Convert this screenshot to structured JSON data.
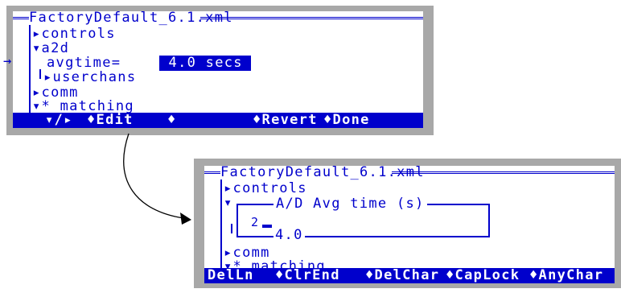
{
  "before": {
    "title": "FactoryDefault_6.1.xml",
    "pointer": "→",
    "items": {
      "controls": "▸controls",
      "a2d": "▾a2d",
      "avgtime_label": "avgtime=",
      "avgtime_value": " 4.0 secs ",
      "userchans": "▸userchans",
      "comm": "▸comm",
      "matching": "▾* matching"
    },
    "statusbar": {
      "toggle": "▾/▸",
      "edit": "♦Edit",
      "blank": "♦",
      "revert": "♦Revert",
      "done": "♦Done"
    }
  },
  "after": {
    "title": "FactoryDefault_6.1.xml",
    "items": {
      "controls": "▸controls",
      "a2d_marker": "▾",
      "comm": "▸comm",
      "matching": "▾* matching"
    },
    "dialog": {
      "title": "A/D Avg time (s)",
      "input": "2",
      "current": "4.0"
    },
    "statusbar": {
      "delln": "DelLn",
      "clrend": "♦ClrEnd",
      "delchar": "♦DelChar",
      "caplock": "♦CapLock",
      "anychar": "♦AnyChar"
    }
  },
  "colors": {
    "text": "#0000cc",
    "panel": "#a8a8a8",
    "background": "#ffffff"
  }
}
